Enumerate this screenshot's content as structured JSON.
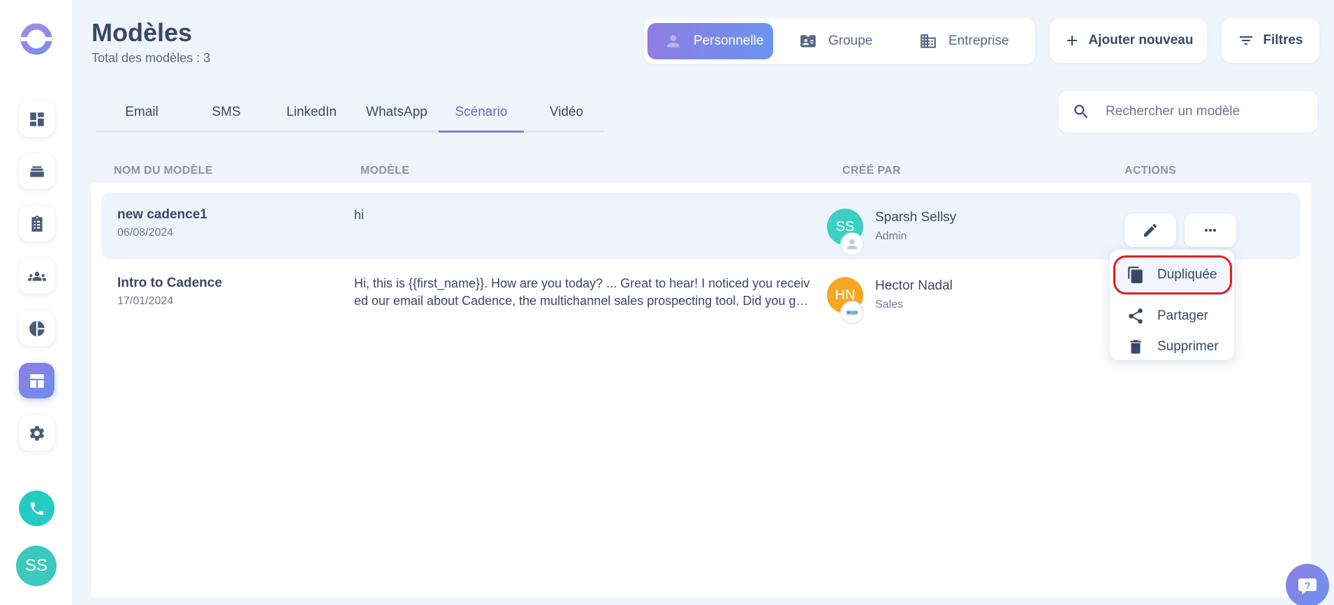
{
  "header": {
    "title": "Modèles",
    "subtitle": "Total des modèles : 3"
  },
  "scope": {
    "options": [
      {
        "label": "Personnelle",
        "icon": "person-icon",
        "active": true
      },
      {
        "label": "Groupe",
        "icon": "id-card-icon",
        "active": false
      },
      {
        "label": "Entreprise",
        "icon": "building-icon",
        "active": false
      }
    ]
  },
  "toolbar": {
    "add_label": "Ajouter nouveau",
    "filter_label": "Filtres"
  },
  "tabs": [
    {
      "label": "Email",
      "active": false
    },
    {
      "label": "SMS",
      "active": false
    },
    {
      "label": "LinkedIn",
      "active": false
    },
    {
      "label": "WhatsApp",
      "active": false
    },
    {
      "label": "Scénario",
      "active": true
    },
    {
      "label": "Vidéo",
      "active": false
    }
  ],
  "search": {
    "placeholder": "Rechercher un modèle"
  },
  "table": {
    "columns": [
      "NOM DU MODÈLE",
      "MODÈLE",
      "CRÉÉ PAR",
      "ACTIONS"
    ],
    "rows": [
      {
        "name": "new cadence1",
        "date": "06/08/2024",
        "body": "hi",
        "creator_initials": "SS",
        "creator_name": "Sparsh Sellsy",
        "creator_role": "Admin",
        "avatar_color": "#3ccfc6"
      },
      {
        "name": "Intro to Cadence",
        "date": "17/01/2024",
        "body": "Hi, this is {{first_name}}. How are you today? ... Great to hear! I noticed you received our email about Cadence, the multichannel sales prospecting tool. Did you get a chance to look at it?",
        "creator_initials": "HN",
        "creator_name": "Hector Nadal",
        "creator_role": "Sales",
        "avatar_color": "#f5a623"
      }
    ]
  },
  "menu": {
    "items": [
      {
        "label": "Dupliquée",
        "icon": "copy-icon"
      },
      {
        "label": "Partager",
        "icon": "share-icon"
      },
      {
        "label": "Supprimer",
        "icon": "trash-icon"
      }
    ]
  },
  "sidebar": {
    "user_initials": "SS"
  },
  "colors": {
    "accent": "#7b7ee4",
    "focus_ring": "#e31b23",
    "teal": "#24cbc3"
  }
}
